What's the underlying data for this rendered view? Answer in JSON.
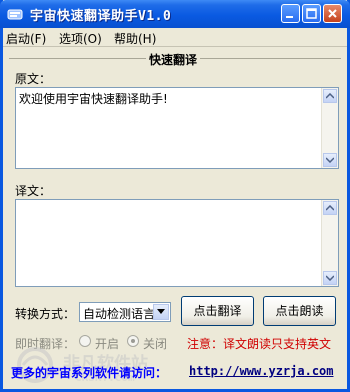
{
  "window": {
    "title": "宇宙快速翻译助手V1.0",
    "menu": [
      "启动(F)",
      "选项(O)",
      "帮助(H)"
    ]
  },
  "group": {
    "title": "快速翻译"
  },
  "source": {
    "label": "原文：",
    "value": "欢迎使用宇宙快速翻译助手!"
  },
  "target": {
    "label": "译文：",
    "value": ""
  },
  "controls": {
    "mode_label": "转换方式：",
    "mode_selected": "自动检测语言",
    "translate_button": "点击翻译",
    "read_button": "点击朗读"
  },
  "instant": {
    "label": "即时翻译：",
    "on_label": "开启",
    "off_label": "关闭",
    "selected": "关闭"
  },
  "note": "注意：译文朗读只支持英文",
  "footer": {
    "text": "更多的宇宙系列软件请访问：",
    "link": "http://www.yzrja.com"
  },
  "watermark": {
    "text": "非凡软件站",
    "sub": "CRSKY.com"
  },
  "colors": {
    "titlebar": "#0a5ae2",
    "note": "#d00000",
    "footer": "#0000ff"
  }
}
